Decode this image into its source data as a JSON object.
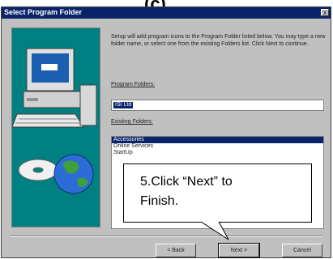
{
  "top_mark": "(c)",
  "dialog": {
    "title": "Select Program Folder",
    "close_glyph": "x",
    "instructions": "Setup will add program icons to the Program Folder listed below. You may type a new folder name, or select one from the existing Folders list. Click Next to continue.",
    "program_folders_label": "Program Folders:",
    "program_folder_value": "ISI Ltd",
    "existing_folders_label": "Existing Folders:",
    "existing_folders": [
      "Accessories",
      "Online Services",
      "StartUp"
    ],
    "selected_index": 0,
    "buttons": {
      "back": "< Back",
      "next": "Next >",
      "cancel": "Cancel"
    }
  },
  "callout": {
    "line1": "5.Click “Next” to",
    "line2": "Finish."
  },
  "colors": {
    "titlebar": "#0a246a",
    "dialog_bg": "#c0c0c0",
    "panel_bg": "#008080",
    "selection": "#0a246a"
  }
}
